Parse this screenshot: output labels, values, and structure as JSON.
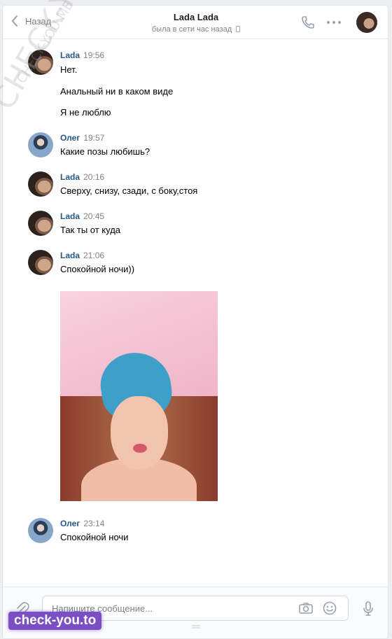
{
  "header": {
    "back_label": "Назад",
    "title": "Lada Lada",
    "status": "была в сети час назад"
  },
  "messages": [
    {
      "author": "Lada",
      "time": "19:56",
      "lines": [
        "Нет.",
        "Анальный ни в каком виде",
        "Я не люблю"
      ]
    },
    {
      "author": "Олег",
      "time": "19:57",
      "lines": [
        "Какие позы любишь?"
      ]
    },
    {
      "author": "Lada",
      "time": "20:16",
      "lines": [
        "Сверху, снизу, сзади, с боку,стоя"
      ]
    },
    {
      "author": "Lada",
      "time": "20:45",
      "lines": [
        "Так ты от куда"
      ]
    },
    {
      "author": "Lada",
      "time": "21:06",
      "lines": [
        "Спокойной ночи))"
      ]
    },
    {
      "author": "Олег",
      "time": "23:14",
      "lines": [
        "Спокойной ночи"
      ]
    }
  ],
  "composer": {
    "placeholder": "Напишите сообщение..."
  },
  "watermarks": {
    "diagonal": "CHECK-YOU.ME",
    "small": "CHECK-YOU.ME",
    "badge": "check-you.to"
  },
  "colors": {
    "link": "#2a5885",
    "muted": "#828282",
    "badge": "#7a4fc4"
  }
}
